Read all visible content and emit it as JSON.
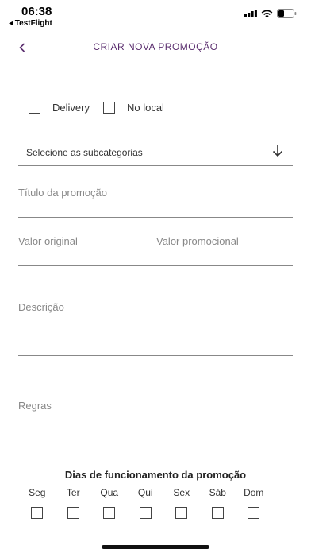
{
  "status": {
    "time": "06:38",
    "back_app": "◂ TestFlight"
  },
  "header": {
    "title": "CRIAR NOVA PROMOÇÃO"
  },
  "options": {
    "delivery": "Delivery",
    "no_local": "No local"
  },
  "subcategory": {
    "label": "Selecione as subcategorias"
  },
  "fields": {
    "titulo": "Título da promoção",
    "valor_original": "Valor original",
    "valor_promocional": "Valor promocional",
    "descricao": "Descrição",
    "regras": "Regras"
  },
  "days": {
    "title": "Dias de funcionamento da promoção",
    "items": [
      "Seg",
      "Ter",
      "Qua",
      "Qui",
      "Sex",
      "Sáb",
      "Dom"
    ]
  },
  "colors": {
    "accent": "#5a2d6e"
  },
  "icons": {
    "back": "chevron-left-icon",
    "dropdown": "arrow-down-icon"
  }
}
